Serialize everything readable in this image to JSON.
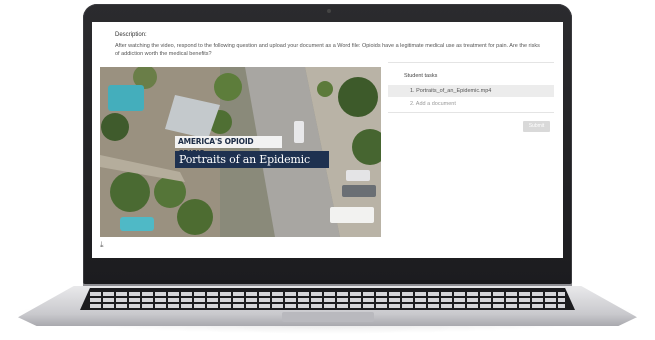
{
  "description": {
    "label": "Description:",
    "text": "After watching the video, respond to the following question and upload your document as a Word file: Opioids have a legitimate medical use as treatment for pain. Are the risks of addiction worth the medical benefits?"
  },
  "video": {
    "title_line1": "AMERICA'S OPIOID CRISIS:",
    "title_line2": "Portraits of an Epidemic",
    "download_icon": "download-icon"
  },
  "tasks": {
    "title": "Student tasks",
    "items": [
      {
        "label": "1. Portraits_of_an_Epidemic.mp4"
      },
      {
        "label": "2. Add a document"
      }
    ],
    "submit_label": "Submit"
  },
  "colors": {
    "banner_navy": "#1e3150",
    "task_highlight": "#ececec",
    "submit_disabled": "#d9d9d9"
  }
}
